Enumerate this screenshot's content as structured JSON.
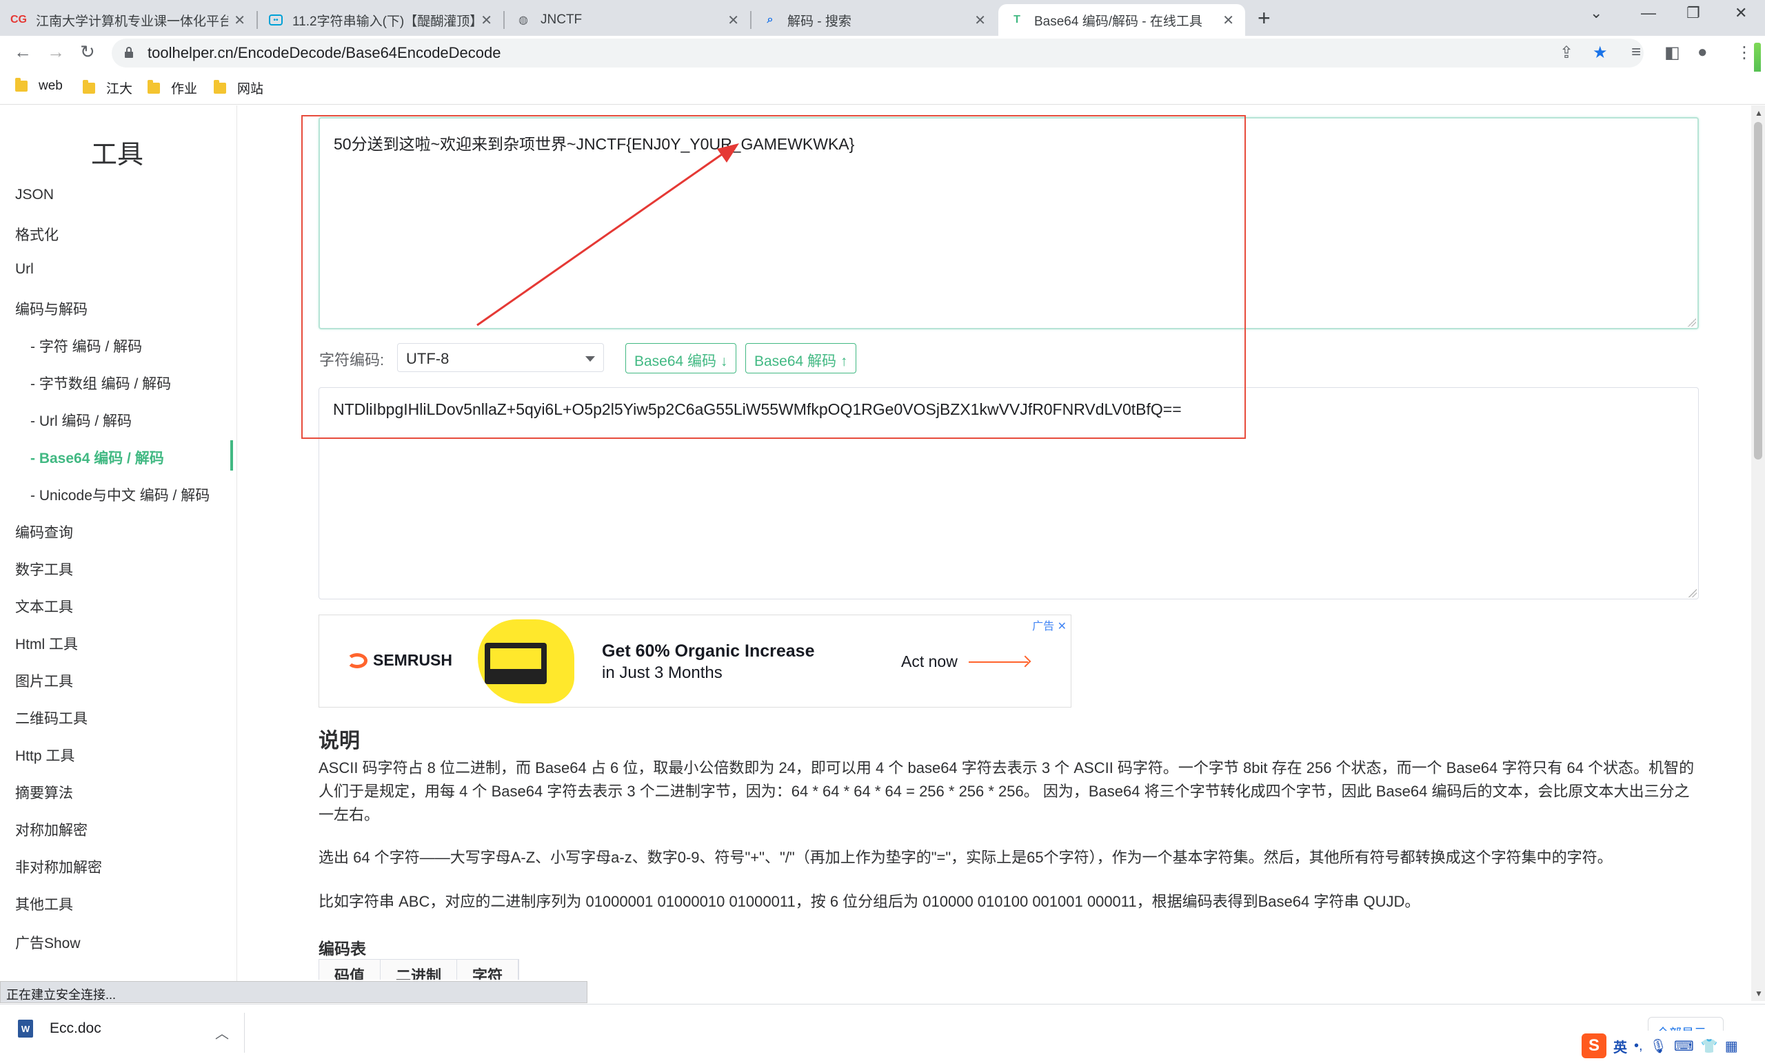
{
  "tabs": [
    {
      "title": "江南大学计算机专业课一体化平台",
      "icon": "cg-logo-icon"
    },
    {
      "title": "11.2字符串输入(下)【醍醐灌顶】",
      "icon": "bilibili-icon"
    },
    {
      "title": "JNCTF",
      "icon": "globe-icon"
    },
    {
      "title": "解码 - 搜索",
      "icon": "search-icon"
    },
    {
      "title": "Base64 编码/解码 - 在线工具",
      "icon": "toolhelper-icon",
      "active": true
    }
  ],
  "address": {
    "url": "toolhelper.cn/EncodeDecode/Base64EncodeDecode"
  },
  "bookmarks": [
    "web",
    "江大",
    "作业",
    "网站"
  ],
  "sidebar": {
    "title": "工具",
    "items": [
      {
        "label": "JSON"
      },
      {
        "label": "格式化"
      },
      {
        "label": "Url"
      },
      {
        "label": "编码与解码"
      },
      {
        "label": "- 字符 编码 / 解码",
        "sub": true
      },
      {
        "label": "- 字节数组 编码 / 解码",
        "sub": true
      },
      {
        "label": "- Url 编码 / 解码",
        "sub": true
      },
      {
        "label": "- Base64 编码 / 解码",
        "sub": true,
        "active": true
      },
      {
        "label": "- Unicode与中文 编码 / 解码",
        "sub": true
      },
      {
        "label": "编码查询"
      },
      {
        "label": "数字工具"
      },
      {
        "label": "文本工具"
      },
      {
        "label": "Html 工具"
      },
      {
        "label": "图片工具"
      },
      {
        "label": "二维码工具"
      },
      {
        "label": "Http 工具"
      },
      {
        "label": "摘要算法"
      },
      {
        "label": "对称加解密"
      },
      {
        "label": "非对称加解密"
      },
      {
        "label": "其他工具"
      },
      {
        "label": "广告Show"
      }
    ]
  },
  "tool": {
    "input_text": "50分送到这啦~欢迎来到杂项世界~JNCTF{ENJ0Y_Y0UR_GAMEWKWKA}",
    "charset_label": "字符编码:",
    "charset_value": "UTF-8",
    "encode_button": "Base64 编码 ↓",
    "decode_button": "Base64 解码 ↑",
    "output_text": "NTDliIbpgIHliLDov5nllaZ+5qyi6L+O5p2l5Yiw5p2C6aG55LiW55WMfkpOQ1RGe0VOSjBZX1kwVVJfR0FNRVdLV0tBfQ=="
  },
  "ad": {
    "badge": "广告",
    "brand": "SEMRUSH",
    "headline": "Get 60% Organic Increase",
    "subline": "in Just 3 Months",
    "cta": "Act now"
  },
  "description": {
    "heading": "说明",
    "para1": "ASCII 码字符占 8 位二进制，而 Base64 占 6 位，取最小公倍数即为 24，即可以用 4 个 base64 字符去表示 3 个 ASCII 码字符。一个字节 8bit 存在 256 个状态，而一个 Base64 字符只有 64 个状态。机智的人们于是规定，用每 4 个 Base64 字符去表示 3 个二进制字节，因为：64 * 64 * 64 * 64 = 256 * 256 * 256。 因为，Base64 将三个字节转化成四个字节，因此 Base64 编码后的文本，会比原文本大出三分之一左右。",
    "para2": "选出 64 个字符——大写字母A-Z、小写字母a-z、数字0-9、符号\"+\"、\"/\"（再加上作为垫字的\"=\"，实际上是65个字符），作为一个基本字符集。然后，其他所有符号都转换成这个字符集中的字符。",
    "para3": "比如字符串 ABC，对应的二进制序列为 01000001 01000010 01000011，按 6 位分组后为 010000 010100 001001 000011，根据编码表得到Base64 字符串 QUJD。",
    "table_heading": "编码表",
    "table_headers": [
      "码值",
      "二进制",
      "字符"
    ]
  },
  "status": "正在建立安全连接...",
  "download": {
    "filename": "Ecc.doc",
    "show_all": "全部显示"
  },
  "ime": {
    "lang": "英"
  }
}
